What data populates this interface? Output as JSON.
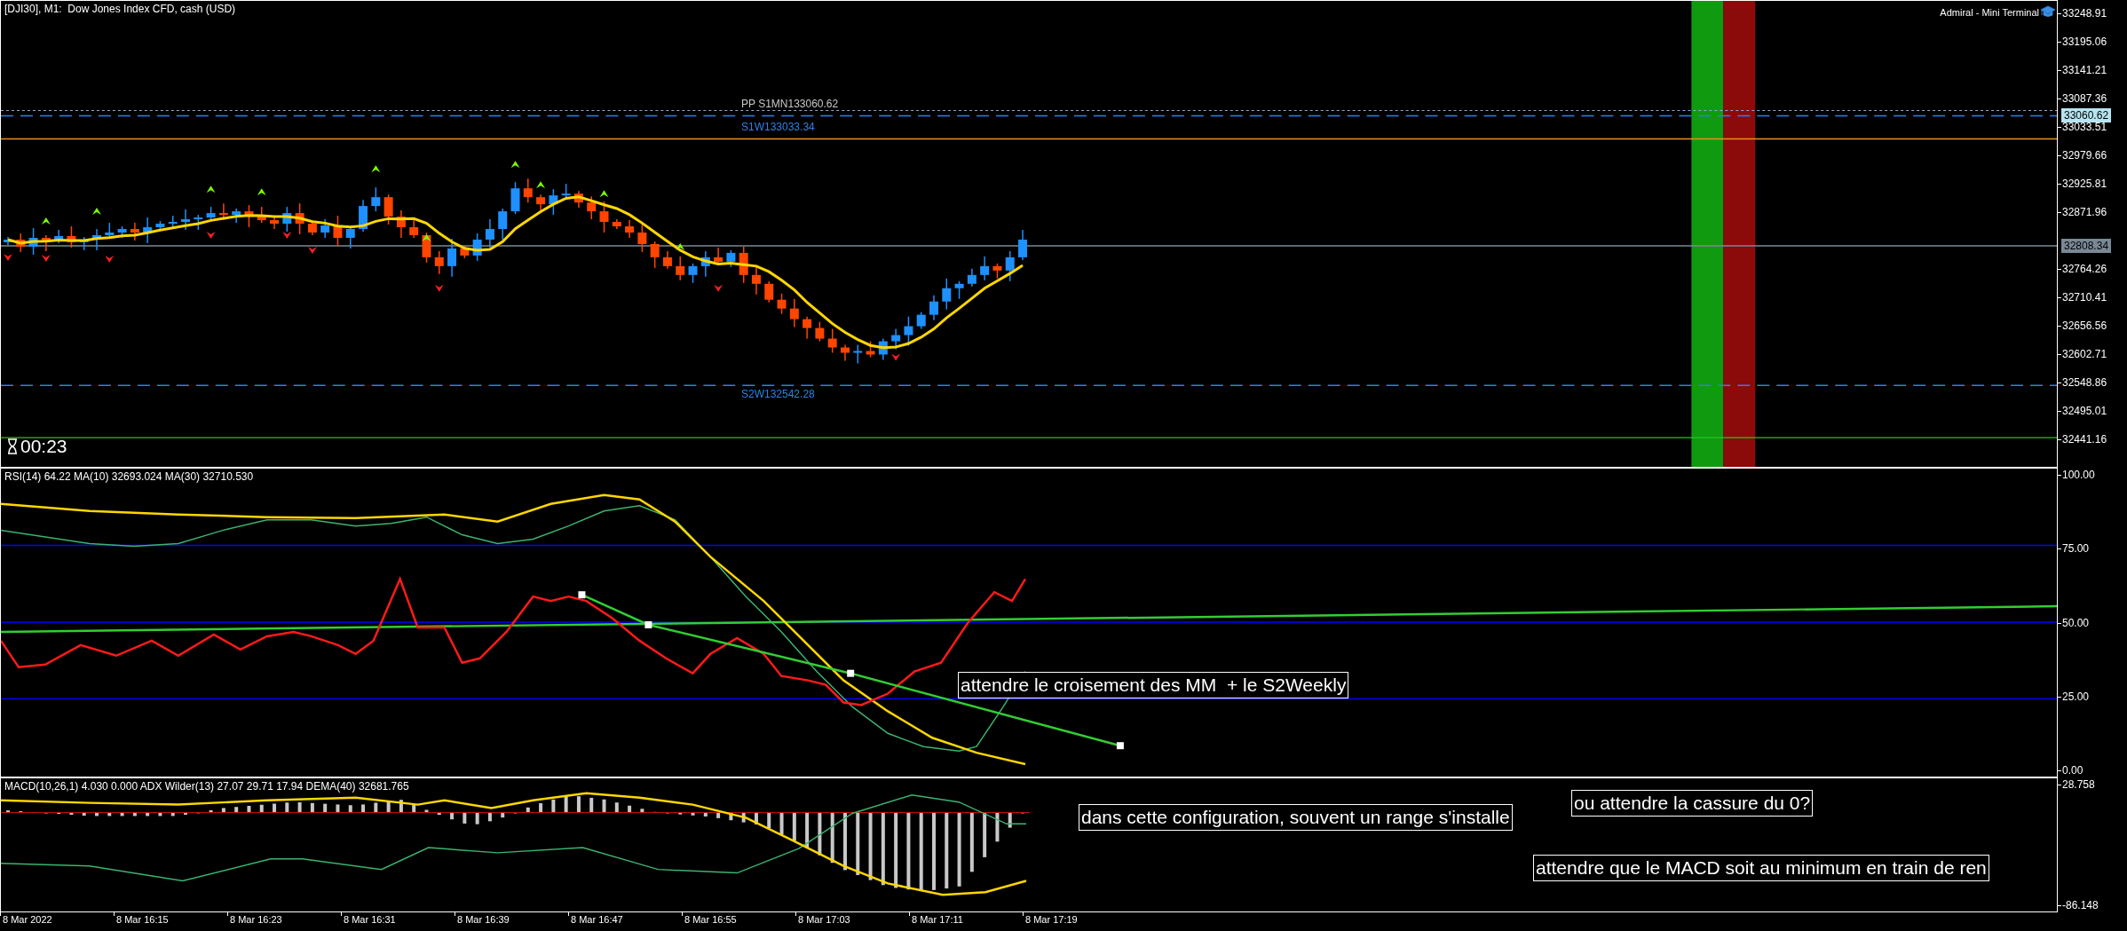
{
  "chart": {
    "title": "[DJI30], M1:  Dow Jones Index CFD, cash (USD)",
    "terminal_label": "Admiral - Mini Terminal",
    "price_ticks": [
      "33248.91",
      "33195.06",
      "33141.21",
      "33087.36",
      "33033.51",
      "32979.66",
      "32925.81",
      "32871.96",
      "32764.26",
      "32710.41",
      "32656.56",
      "32602.71",
      "32548.86",
      "32495.01",
      "32441.16"
    ],
    "price_markers": [
      {
        "text": "33060.62",
        "kind": "pivot"
      },
      {
        "text": "32808.34",
        "kind": "bid"
      }
    ],
    "level_labels": [
      {
        "text": "PP S1MN133060.62",
        "color": "#c8c8c8"
      },
      {
        "text": "S1W133033.34",
        "color": "#2f80e8"
      },
      {
        "text": "S2W132542.28",
        "color": "#2f80e8"
      }
    ],
    "timer": "00:23"
  },
  "rsi": {
    "header": "RSI(14) 64.22 MA(10) 32693.024 MA(30) 32710.530",
    "ticks": [
      "100.00",
      "75.00",
      "50.00",
      "25.00",
      "0.00"
    ],
    "note": "attendre le croisement des MM  + le S2Weekly"
  },
  "macd": {
    "header": "MACD(10,26,1) 4.030 0.000 ADX Wilder(13) 27.07 29.71 17.94 DEMA(40) 32681.765",
    "ticks": [
      "28.758",
      "-86.148"
    ],
    "notes": [
      "dans cette configuration, souvent un range s'installe",
      "ou attendre la cassure du 0?",
      "attendre que le MACD soit au minimum en train de ren"
    ]
  },
  "time_axis": {
    "labels": [
      "8 Mar 2022",
      "8 Mar 16:15",
      "8 Mar 16:23",
      "8 Mar 16:31",
      "8 Mar 16:39",
      "8 Mar 16:47",
      "8 Mar 16:55",
      "8 Mar 17:03",
      "8 Mar 17:11",
      "8 Mar 17:19"
    ]
  }
}
